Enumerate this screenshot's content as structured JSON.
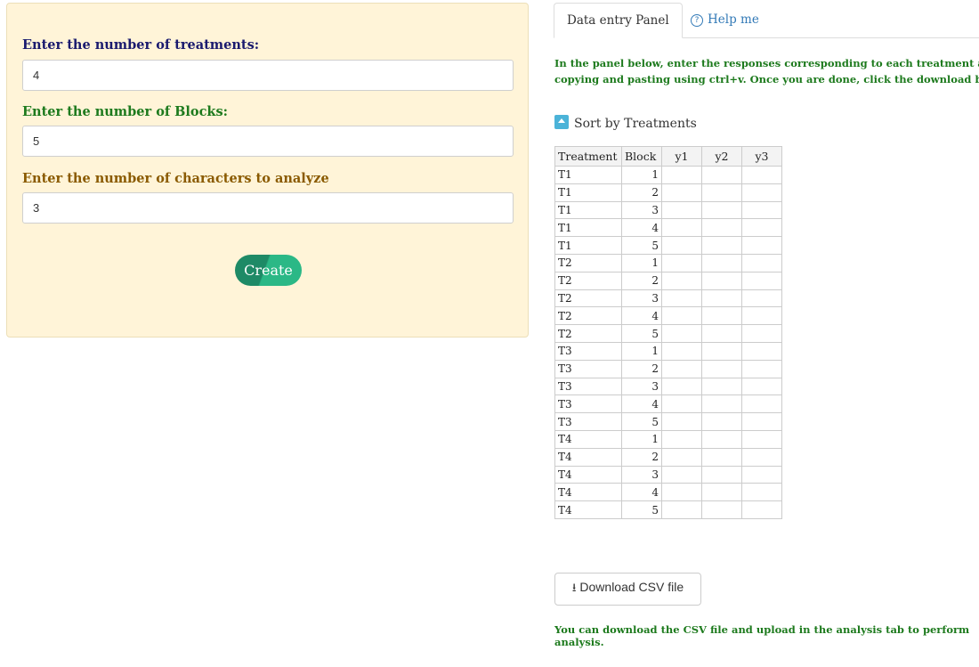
{
  "form": {
    "treatments_label": "Enter the number of treatments:",
    "treatments_value": "4",
    "blocks_label": "Enter the number of Blocks:",
    "blocks_value": "5",
    "characters_label": "Enter the number of characters to analyze",
    "characters_value": "3",
    "create_label": "Create"
  },
  "tabs": {
    "data_entry": "Data entry Panel",
    "help": "Help me"
  },
  "instructions": {
    "line1": "In the panel below, enter the responses corresponding to each treatment and block, for",
    "line2": "copying and pasting using ctrl+v. Once you are done, click the download button to save th"
  },
  "sort_label": "Sort by Treatments",
  "grid": {
    "headers": [
      "Treatment",
      "Block",
      "y1",
      "y2",
      "y3"
    ],
    "rows": [
      [
        "T1",
        "1"
      ],
      [
        "T1",
        "2"
      ],
      [
        "T1",
        "3"
      ],
      [
        "T1",
        "4"
      ],
      [
        "T1",
        "5"
      ],
      [
        "T2",
        "1"
      ],
      [
        "T2",
        "2"
      ],
      [
        "T2",
        "3"
      ],
      [
        "T2",
        "4"
      ],
      [
        "T2",
        "5"
      ],
      [
        "T3",
        "1"
      ],
      [
        "T3",
        "2"
      ],
      [
        "T3",
        "3"
      ],
      [
        "T3",
        "4"
      ],
      [
        "T3",
        "5"
      ],
      [
        "T4",
        "1"
      ],
      [
        "T4",
        "2"
      ],
      [
        "T4",
        "3"
      ],
      [
        "T4",
        "4"
      ],
      [
        "T4",
        "5"
      ]
    ]
  },
  "download_label": "Download CSV file",
  "footer_note": "You can download the CSV file and upload in the analysis tab to perform analysis."
}
